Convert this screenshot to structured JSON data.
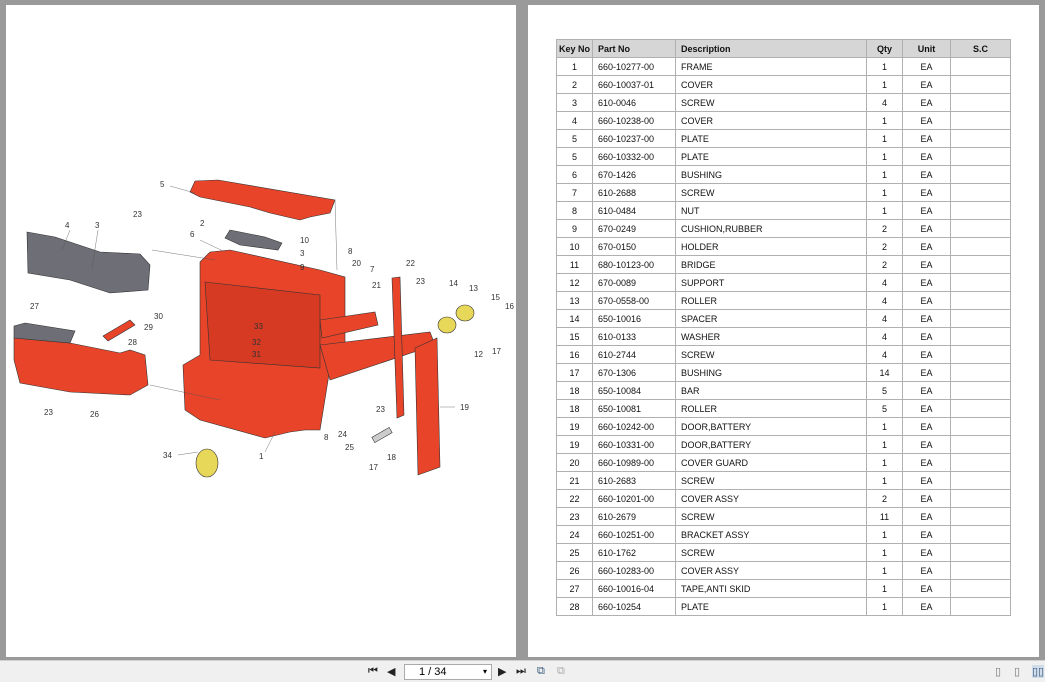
{
  "diagram": {
    "callouts": [
      "5",
      "23",
      "4",
      "3",
      "2",
      "6",
      "10",
      "3",
      "9",
      "8",
      "20",
      "7",
      "21",
      "22",
      "23",
      "14",
      "13",
      "15",
      "16",
      "27",
      "30",
      "29",
      "28",
      "33",
      "32",
      "31",
      "12",
      "17",
      "19",
      "23",
      "26",
      "23",
      "8",
      "24",
      "25",
      "18",
      "17",
      "34",
      "1"
    ]
  },
  "parts_table": {
    "headers": [
      "Key No",
      "Part No",
      "Description",
      "Qty",
      "Unit",
      "S.C"
    ],
    "rows": [
      [
        "1",
        "660-10277-00",
        "FRAME",
        "1",
        "EA",
        ""
      ],
      [
        "2",
        "660-10037-01",
        "COVER",
        "1",
        "EA",
        ""
      ],
      [
        "3",
        "610-0046",
        "SCREW",
        "4",
        "EA",
        ""
      ],
      [
        "4",
        "660-10238-00",
        "COVER",
        "1",
        "EA",
        ""
      ],
      [
        "5",
        "660-10237-00",
        "PLATE",
        "1",
        "EA",
        ""
      ],
      [
        "5",
        "660-10332-00",
        "PLATE",
        "1",
        "EA",
        ""
      ],
      [
        "6",
        "670-1426",
        "BUSHING",
        "1",
        "EA",
        ""
      ],
      [
        "7",
        "610-2688",
        "SCREW",
        "1",
        "EA",
        ""
      ],
      [
        "8",
        "610-0484",
        "NUT",
        "1",
        "EA",
        ""
      ],
      [
        "9",
        "670-0249",
        "CUSHION,RUBBER",
        "2",
        "EA",
        ""
      ],
      [
        "10",
        "670-0150",
        "HOLDER",
        "2",
        "EA",
        ""
      ],
      [
        "11",
        "680-10123-00",
        "BRIDGE",
        "2",
        "EA",
        ""
      ],
      [
        "12",
        "670-0089",
        "SUPPORT",
        "4",
        "EA",
        ""
      ],
      [
        "13",
        "670-0558-00",
        "ROLLER",
        "4",
        "EA",
        ""
      ],
      [
        "14",
        "650-10016",
        "SPACER",
        "4",
        "EA",
        ""
      ],
      [
        "15",
        "610-0133",
        "WASHER",
        "4",
        "EA",
        ""
      ],
      [
        "16",
        "610-2744",
        "SCREW",
        "4",
        "EA",
        ""
      ],
      [
        "17",
        "670-1306",
        "BUSHING",
        "14",
        "EA",
        ""
      ],
      [
        "18",
        "650-10084",
        "BAR",
        "5",
        "EA",
        ""
      ],
      [
        "18",
        "650-10081",
        "ROLLER",
        "5",
        "EA",
        ""
      ],
      [
        "19",
        "660-10242-00",
        "DOOR,BATTERY",
        "1",
        "EA",
        ""
      ],
      [
        "19",
        "660-10331-00",
        "DOOR,BATTERY",
        "1",
        "EA",
        ""
      ],
      [
        "20",
        "660-10989-00",
        "COVER GUARD",
        "1",
        "EA",
        ""
      ],
      [
        "21",
        "610-2683",
        "SCREW",
        "1",
        "EA",
        ""
      ],
      [
        "22",
        "660-10201-00",
        "COVER ASSY",
        "2",
        "EA",
        ""
      ],
      [
        "23",
        "610-2679",
        "SCREW",
        "11",
        "EA",
        ""
      ],
      [
        "24",
        "660-10251-00",
        "BRACKET ASSY",
        "1",
        "EA",
        ""
      ],
      [
        "25",
        "610-1762",
        "SCREW",
        "1",
        "EA",
        ""
      ],
      [
        "26",
        "660-10283-00",
        "COVER ASSY",
        "1",
        "EA",
        ""
      ],
      [
        "27",
        "660-10016-04",
        "TAPE,ANTI SKID",
        "1",
        "EA",
        ""
      ],
      [
        "28",
        "660-10254",
        "PLATE",
        "1",
        "EA",
        ""
      ]
    ]
  },
  "toolbar": {
    "page_indicator": "1 / 34"
  },
  "colors": {
    "part_red": "#e8442a",
    "part_gray": "#6e6e76",
    "wheel_yellow": "#e8d85a"
  }
}
